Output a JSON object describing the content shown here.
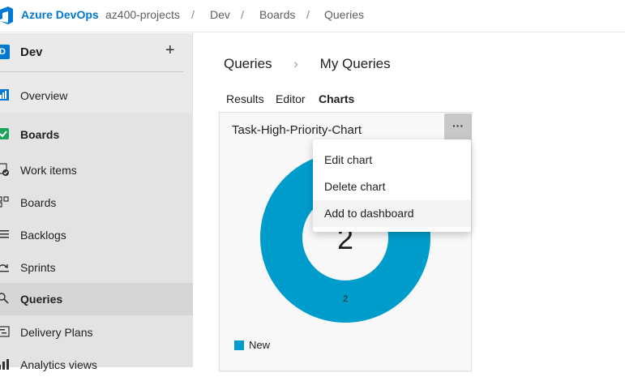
{
  "topbar": {
    "brand": "Azure DevOps",
    "breadcrumbs": [
      "az400-projects",
      "Dev",
      "Boards",
      "Queries"
    ],
    "separator": "/"
  },
  "sidebar": {
    "project_initial": "D",
    "project_name": "Dev",
    "add_label": "+",
    "items": [
      {
        "label": "Overview",
        "icon": "overview-icon"
      },
      {
        "label": "Boards",
        "icon": "boards-hub-icon"
      },
      {
        "label": "Work items",
        "icon": "work-items-icon"
      },
      {
        "label": "Boards",
        "icon": "boards-icon"
      },
      {
        "label": "Backlogs",
        "icon": "backlogs-icon"
      },
      {
        "label": "Sprints",
        "icon": "sprints-icon"
      },
      {
        "label": "Queries",
        "icon": "queries-icon"
      },
      {
        "label": "Delivery Plans",
        "icon": "delivery-plans-icon"
      },
      {
        "label": "Analytics views",
        "icon": "analytics-views-icon"
      }
    ]
  },
  "main": {
    "breadcrumb_root": "Queries",
    "breadcrumb_chevron": "›",
    "breadcrumb_current": "My Queries",
    "tabs": [
      {
        "label": "Results"
      },
      {
        "label": "Editor"
      },
      {
        "label": "Charts",
        "active": true
      }
    ]
  },
  "chart_card": {
    "title": "Task-High-Priority-Chart",
    "more_label": "···",
    "center_total": "2",
    "colors": {
      "new": "#009ccc"
    }
  },
  "chart_data": {
    "type": "pie",
    "labels": [
      "New"
    ],
    "values": [
      2
    ],
    "total": 2,
    "legend_position": "bottom-left"
  },
  "context_menu": {
    "items": [
      {
        "label": "Edit chart"
      },
      {
        "label": "Delete chart"
      },
      {
        "label": "Add to dashboard",
        "hovered": true
      }
    ]
  }
}
